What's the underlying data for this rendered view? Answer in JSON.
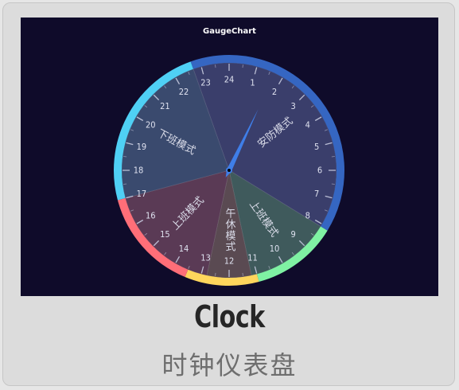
{
  "card": {
    "title": "Clock",
    "subtitle": "时钟仪表盘"
  },
  "chart_data": {
    "type": "gauge",
    "title": "GaugeChart",
    "hour_labels": [
      "24",
      "1",
      "2",
      "3",
      "4",
      "5",
      "6",
      "7",
      "8",
      "9",
      "10",
      "11",
      "12",
      "13",
      "14",
      "15",
      "16",
      "17",
      "18",
      "19",
      "20",
      "21",
      "22",
      "23"
    ],
    "range": [
      0,
      24
    ],
    "pointer_value": 1.7,
    "sectors": [
      {
        "label": "安防模式",
        "start": 22.7,
        "end": 8.1,
        "fill": "#3a3e6b"
      },
      {
        "label": "上班模式",
        "start": 8.1,
        "end": 11.2,
        "fill": "#3f5a5c"
      },
      {
        "label": "午休模式",
        "start": 11.2,
        "end": 12.8,
        "fill": "#5a4a52"
      },
      {
        "label": "上班模式",
        "start": 12.8,
        "end": 17.0,
        "fill": "#5a3a55"
      },
      {
        "label": "下班模式",
        "start": 17.0,
        "end": 22.7,
        "fill": "#3a4a6e"
      }
    ],
    "rim_segments": [
      {
        "start": 22.7,
        "end": 8.1,
        "color": "#3566c2"
      },
      {
        "start": 8.1,
        "end": 11.0,
        "color": "#7ff2a3"
      },
      {
        "start": 11.0,
        "end": 13.5,
        "color": "#ffd65c"
      },
      {
        "start": 13.5,
        "end": 17.0,
        "color": "#ff6e78"
      },
      {
        "start": 17.0,
        "end": 22.7,
        "color": "#4fd0f5"
      }
    ],
    "colors": {
      "background": "#0f0b2a",
      "tick": "#c7cbe0",
      "label": "#dfe2f0",
      "sector_label": "#d9dbe8",
      "pointer": "#3f7ee8",
      "pointer_center": "#000000"
    }
  }
}
